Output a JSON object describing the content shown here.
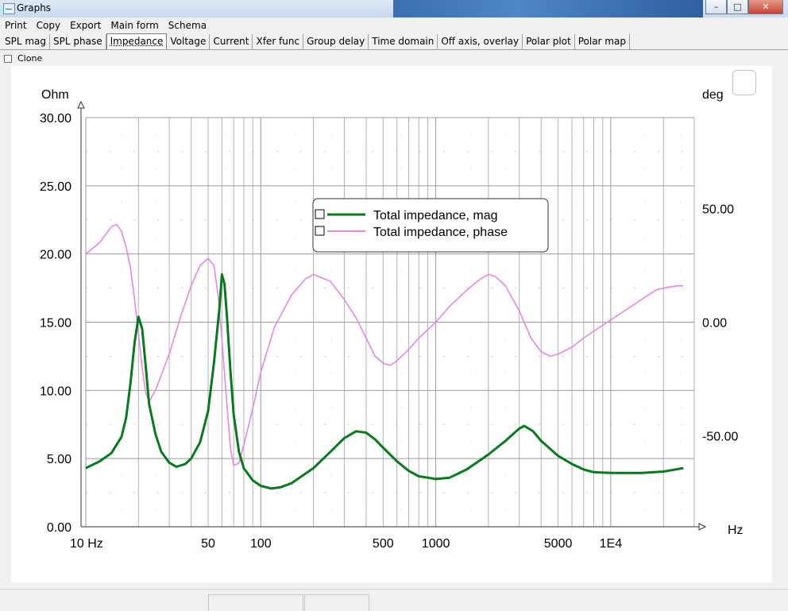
{
  "window": {
    "title": "Graphs",
    "btn_min": "–",
    "btn_max": "□",
    "btn_close": "✕"
  },
  "menu": [
    "Print",
    "Copy",
    "Export",
    "Main form",
    "Schema"
  ],
  "tabs": [
    "SPL mag",
    "SPL phase",
    "Impedance",
    "Voltage",
    "Current",
    "Xfer func",
    "Group delay",
    "Time domain",
    "Off axis, overlay",
    "Polar plot",
    "Polar map"
  ],
  "active_tab": "Impedance",
  "clone": {
    "label": "Clone",
    "checked": false
  },
  "chart_data": {
    "type": "line",
    "x_scale": "log",
    "xlim": [
      10,
      30000
    ],
    "x_tick_labels": [
      "10 Hz",
      "50",
      "100",
      "500",
      "1000",
      "5000",
      "1E4"
    ],
    "x_tick_values": [
      10,
      50,
      100,
      500,
      1000,
      5000,
      10000
    ],
    "xlabel": "Hz",
    "ylabel_left": "Ohm",
    "ylim_left": [
      0,
      30
    ],
    "y_ticks_left": [
      "0.00",
      "5.00",
      "10.00",
      "15.00",
      "20.00",
      "25.00",
      "30.00"
    ],
    "ylabel_right": "deg",
    "ylim_right": [
      -90,
      90
    ],
    "y_ticks_right": [
      "-50.00",
      "0.00",
      "50.00"
    ],
    "y_tick_values_right": [
      -50,
      0,
      50
    ],
    "grid": true,
    "legend_position": "top-center",
    "series": [
      {
        "name": "Total impedance, mag",
        "axis": "left",
        "color": "#087a1e",
        "points": [
          [
            10,
            4.3
          ],
          [
            12,
            4.8
          ],
          [
            14,
            5.4
          ],
          [
            16,
            6.6
          ],
          [
            17,
            8.0
          ],
          [
            18,
            10.5
          ],
          [
            19,
            13.5
          ],
          [
            20,
            15.4
          ],
          [
            21,
            14.5
          ],
          [
            22,
            11.8
          ],
          [
            23,
            9.0
          ],
          [
            25,
            6.8
          ],
          [
            27,
            5.5
          ],
          [
            30,
            4.7
          ],
          [
            33,
            4.4
          ],
          [
            37,
            4.6
          ],
          [
            40,
            5.0
          ],
          [
            45,
            6.2
          ],
          [
            50,
            8.5
          ],
          [
            54,
            12.0
          ],
          [
            58,
            16.0
          ],
          [
            60,
            18.5
          ],
          [
            62,
            17.8
          ],
          [
            64,
            15.5
          ],
          [
            67,
            11.5
          ],
          [
            70,
            8.2
          ],
          [
            75,
            5.5
          ],
          [
            80,
            4.3
          ],
          [
            90,
            3.4
          ],
          [
            100,
            3.0
          ],
          [
            115,
            2.8
          ],
          [
            130,
            2.9
          ],
          [
            150,
            3.2
          ],
          [
            200,
            4.3
          ],
          [
            250,
            5.5
          ],
          [
            300,
            6.5
          ],
          [
            350,
            7.0
          ],
          [
            400,
            6.9
          ],
          [
            450,
            6.4
          ],
          [
            500,
            5.8
          ],
          [
            600,
            4.8
          ],
          [
            700,
            4.1
          ],
          [
            800,
            3.7
          ],
          [
            900,
            3.6
          ],
          [
            1000,
            3.5
          ],
          [
            1200,
            3.6
          ],
          [
            1500,
            4.2
          ],
          [
            2000,
            5.3
          ],
          [
            2500,
            6.3
          ],
          [
            3000,
            7.2
          ],
          [
            3200,
            7.4
          ],
          [
            3600,
            7.0
          ],
          [
            4000,
            6.3
          ],
          [
            5000,
            5.2
          ],
          [
            6000,
            4.6
          ],
          [
            7000,
            4.2
          ],
          [
            8000,
            4.0
          ],
          [
            10000,
            3.95
          ],
          [
            15000,
            3.95
          ],
          [
            20000,
            4.05
          ],
          [
            26000,
            4.3
          ]
        ]
      },
      {
        "name": "Total impedance, phase",
        "axis": "right",
        "color": "#e986e3",
        "points": [
          [
            10,
            30
          ],
          [
            12,
            35
          ],
          [
            14,
            42
          ],
          [
            15,
            43
          ],
          [
            16,
            40
          ],
          [
            17,
            33
          ],
          [
            18,
            24
          ],
          [
            19,
            10
          ],
          [
            20,
            -5
          ],
          [
            21,
            -20
          ],
          [
            22,
            -31
          ],
          [
            23,
            -35
          ],
          [
            25,
            -30
          ],
          [
            30,
            -14
          ],
          [
            35,
            3
          ],
          [
            40,
            16
          ],
          [
            45,
            25
          ],
          [
            50,
            28
          ],
          [
            54,
            25
          ],
          [
            57,
            12
          ],
          [
            60,
            -8
          ],
          [
            64,
            -36
          ],
          [
            67,
            -55
          ],
          [
            70,
            -63
          ],
          [
            75,
            -62
          ],
          [
            80,
            -54
          ],
          [
            90,
            -38
          ],
          [
            100,
            -22
          ],
          [
            120,
            -2
          ],
          [
            150,
            12
          ],
          [
            180,
            19
          ],
          [
            200,
            21
          ],
          [
            250,
            18
          ],
          [
            300,
            10
          ],
          [
            350,
            2
          ],
          [
            400,
            -7
          ],
          [
            450,
            -15
          ],
          [
            500,
            -18
          ],
          [
            550,
            -19
          ],
          [
            600,
            -17
          ],
          [
            700,
            -12
          ],
          [
            800,
            -7
          ],
          [
            1000,
            0
          ],
          [
            1200,
            7
          ],
          [
            1500,
            14
          ],
          [
            1800,
            19
          ],
          [
            2000,
            21
          ],
          [
            2200,
            20
          ],
          [
            2500,
            16
          ],
          [
            3000,
            5
          ],
          [
            3500,
            -7
          ],
          [
            4000,
            -13
          ],
          [
            4500,
            -15
          ],
          [
            5000,
            -14
          ],
          [
            6000,
            -11
          ],
          [
            7000,
            -7
          ],
          [
            8000,
            -4
          ],
          [
            10000,
            1
          ],
          [
            12000,
            5
          ],
          [
            15000,
            10
          ],
          [
            18000,
            14
          ],
          [
            20000,
            15
          ],
          [
            24000,
            16
          ],
          [
            26000,
            16
          ]
        ]
      }
    ]
  }
}
